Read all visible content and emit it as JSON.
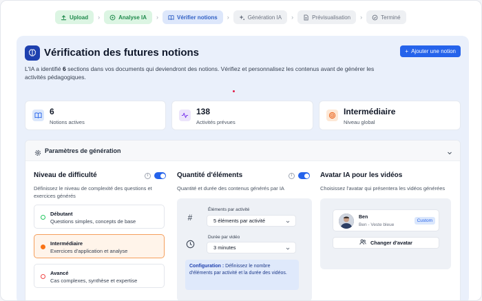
{
  "stepper": {
    "steps": [
      {
        "label": "Upload",
        "state": "done",
        "icon": "upload-icon"
      },
      {
        "label": "Analyse IA",
        "state": "done",
        "icon": "brain-icon"
      },
      {
        "label": "Vérifier notions",
        "state": "active",
        "icon": "book-open-icon"
      },
      {
        "label": "Génération IA",
        "state": "pending",
        "icon": "sparkles-icon"
      },
      {
        "label": "Prévisualisation",
        "state": "pending",
        "icon": "document-icon"
      },
      {
        "label": "Terminé",
        "state": "pending",
        "icon": "check-circle-icon"
      }
    ]
  },
  "header": {
    "title": "Vérification des futures notions",
    "add_button": "Ajouter une notion",
    "desc_prefix": "L'IA a identifié ",
    "desc_count": "6",
    "desc_suffix": " sections dans vos documents qui deviendront des notions. Vérifiez et personnalisez les contenus avant de générer les activités pédagogiques."
  },
  "stats": [
    {
      "value": "6",
      "label": "Notions actives",
      "icon": "book-icon"
    },
    {
      "value": "138",
      "label": "Activités prévues",
      "icon": "activity-icon"
    },
    {
      "value": "Intermédiaire",
      "label": "Niveau global",
      "icon": "target-icon"
    }
  ],
  "params": {
    "title": "Paramètres de génération",
    "difficulty": {
      "title": "Niveau de difficulté",
      "subtitle": "Définissez le niveau de complexité des questions et exercices générés",
      "levels": [
        {
          "name": "Débutant",
          "desc": "Questions simples, concepts de base",
          "color": "#22c55e"
        },
        {
          "name": "Intermédiaire",
          "desc": "Exercices d'application et analyse",
          "color": "#f97316"
        },
        {
          "name": "Avancé",
          "desc": "Cas complexes, synthèse et expertise",
          "color": "#ef4444"
        }
      ]
    },
    "quantity": {
      "title": "Quantité d'éléments",
      "subtitle": "Quantité et durée des contenus générés par IA",
      "per_activity_label": "Éléments par activité",
      "per_activity_value": "5 éléments par activité",
      "duration_label": "Durée par vidéo",
      "duration_value": "3 minutes",
      "note_bold": "Configuration :",
      "note_text": " Définissez le nombre d'éléments par activité et la durée des vidéos."
    },
    "avatar": {
      "title": "Avatar IA pour les vidéos",
      "subtitle": "Choisissez l'avatar qui présentera les vidéos générées",
      "name": "Ben",
      "desc": "Ben - Veste bleue",
      "badge": "Custom",
      "change_button": "Changer d'avatar"
    }
  }
}
